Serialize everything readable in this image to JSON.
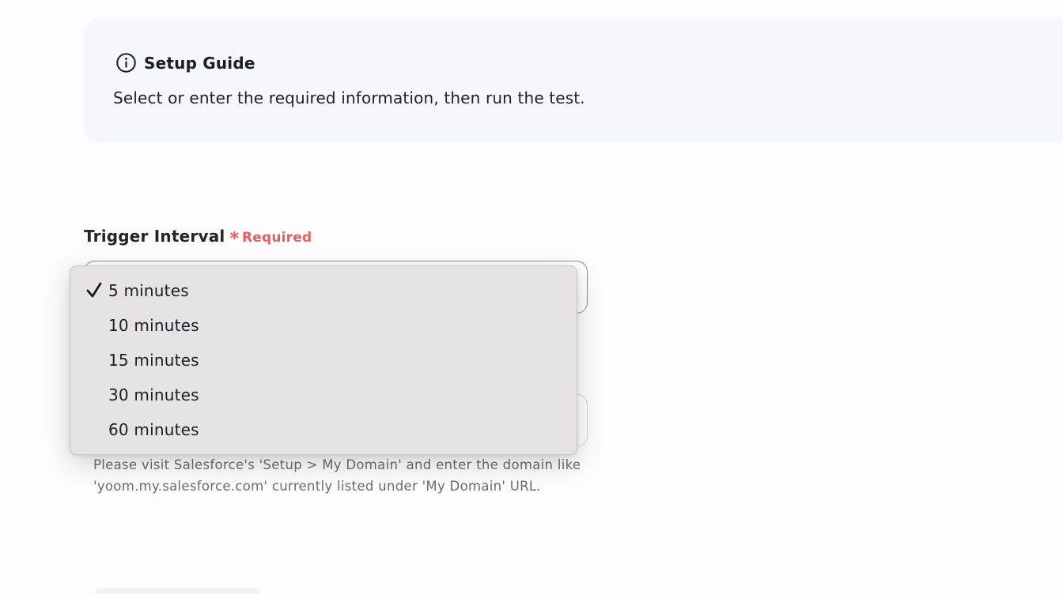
{
  "setup_guide": {
    "title": "Setup Guide",
    "description": "Select or enter the required information, then run the test.",
    "icon": "info-icon"
  },
  "trigger_interval": {
    "label": "Trigger Interval",
    "required_mark": "*",
    "required_label": "Required",
    "selected_value": "5 minutes",
    "options": [
      {
        "label": "5 minutes",
        "selected": true
      },
      {
        "label": "10 minutes",
        "selected": false
      },
      {
        "label": "15 minutes",
        "selected": false
      },
      {
        "label": "30 minutes",
        "selected": false
      },
      {
        "label": "60 minutes",
        "selected": false
      }
    ]
  },
  "domain_field": {
    "help_text": "Please visit Salesforce's 'Setup > My Domain' and enter the domain like 'yoom.my.salesforce.com' currently listed under 'My Domain' URL."
  },
  "colors": {
    "required": "#ef5c5c",
    "guide_background": "#f4f7fb",
    "menu_background": "#e7e3e5"
  }
}
